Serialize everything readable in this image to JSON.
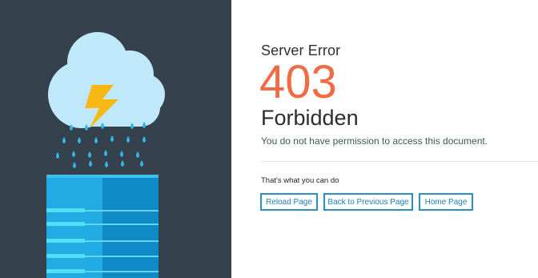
{
  "error": {
    "label": "Server Error",
    "code": "403",
    "title": "Forbidden",
    "message": "You do not have permission to access this document."
  },
  "actions": {
    "heading": "That's what you can do",
    "buttons": [
      {
        "label": "Reload Page"
      },
      {
        "label": "Back to Previous Page"
      },
      {
        "label": "Home Page"
      }
    ]
  },
  "colors": {
    "sidebar_bg": "#35424d",
    "accent_code": "#f16b45",
    "button_border": "#2a8fc4",
    "cloud": "#bfe9fb",
    "bolt": "#f7b814",
    "server": "#1aa3de"
  },
  "icons": [
    "cloud-icon",
    "lightning-bolt-icon",
    "rain-drops-icon",
    "server-stack-icon"
  ]
}
